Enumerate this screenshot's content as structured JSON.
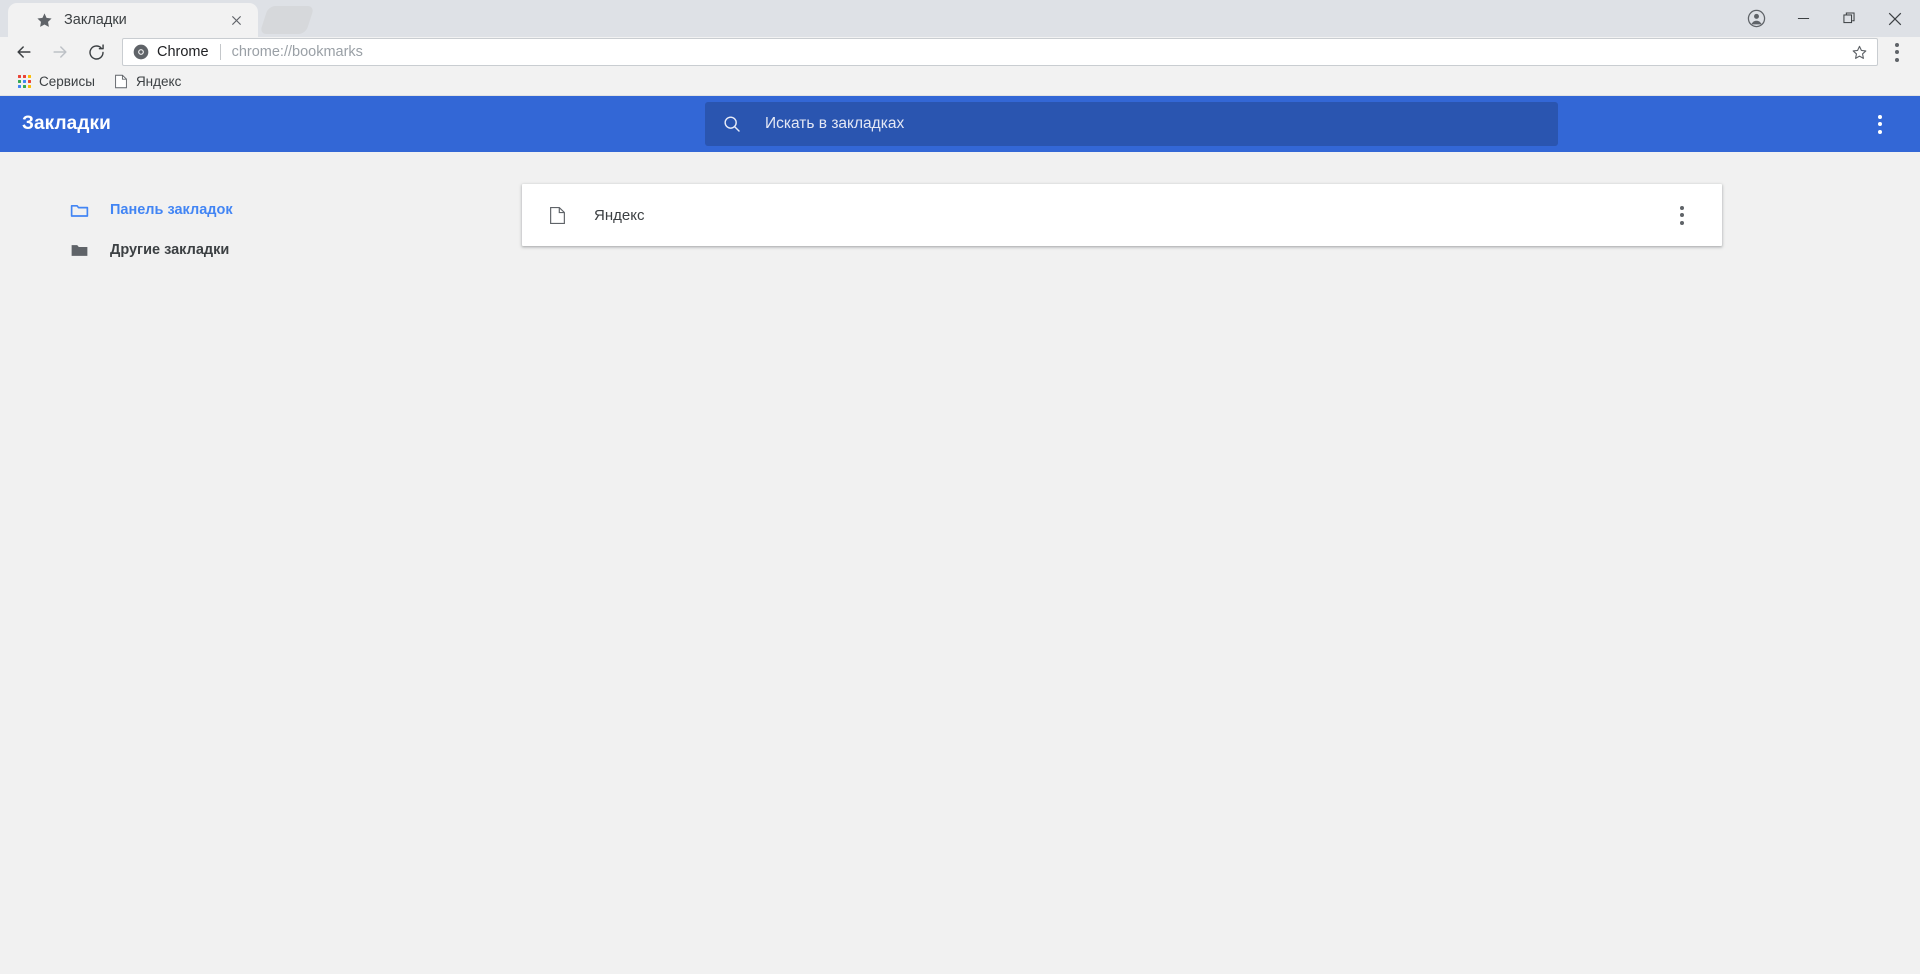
{
  "window": {
    "tabs": [
      {
        "title": "Закладки",
        "favicon": "star-icon",
        "active": true
      }
    ],
    "new_tab_button": "new-tab-button",
    "controls": {
      "profile": "profile-avatar-icon",
      "minimize": "minimize-icon",
      "maximize": "maximize-restore-icon",
      "close": "close-window-icon"
    }
  },
  "toolbar": {
    "back": "back-arrow-icon",
    "forward": "forward-arrow-icon",
    "reload": "reload-icon",
    "omnibox": {
      "scheme_label": "Chrome",
      "url": "chrome://bookmarks",
      "chrome_icon": "chrome-logo-icon",
      "star": "bookmark-star-icon"
    },
    "chrome_menu": "chrome-menu-icon"
  },
  "bookmarks_bar": {
    "items": [
      {
        "label": "Сервисы",
        "icon": "apps-grid-icon"
      },
      {
        "label": "Яндекс",
        "icon": "page-icon"
      }
    ]
  },
  "manager": {
    "title": "Закладки",
    "search": {
      "placeholder": "Искать в закладках",
      "value": "",
      "icon": "search-icon"
    },
    "overflow_menu": "more-options-icon",
    "sidebar": [
      {
        "label": "Панель закладок",
        "icon": "folder-outline-icon",
        "selected": true
      },
      {
        "label": "Другие закладки",
        "icon": "folder-filled-icon",
        "selected": false
      }
    ],
    "list": [
      {
        "label": "Яндекс",
        "icon": "page-icon",
        "menu": "more-options-icon"
      }
    ]
  },
  "colors": {
    "header_blue": "#3367d6",
    "search_blue": "#2a55b0",
    "accent_blue": "#4285f4",
    "tabstrip_bg": "#dee1e6",
    "toolbar_bg": "#f2f2f2",
    "content_bg": "#f1f1f1"
  }
}
